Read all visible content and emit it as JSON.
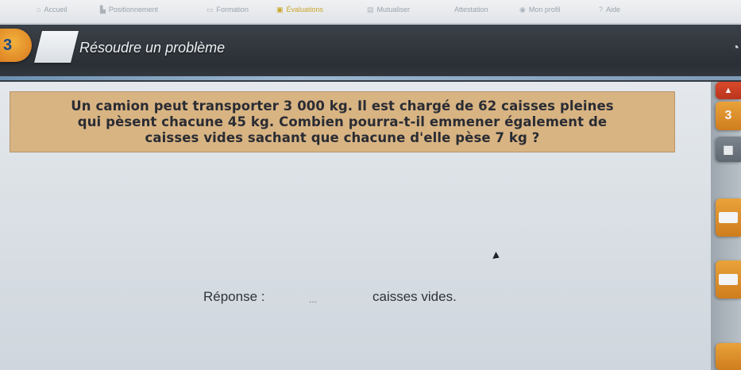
{
  "nav": {
    "items": [
      {
        "label": "Accueil",
        "icon": "home-icon"
      },
      {
        "label": "Positionnement",
        "icon": "chart-icon"
      },
      {
        "label": "Formation",
        "icon": "book-icon"
      },
      {
        "label": "Évaluations",
        "icon": "clipboard-icon",
        "active": true
      },
      {
        "label": "Mutualiser",
        "icon": "share-icon"
      },
      {
        "label": "Attestation",
        "icon": ""
      },
      {
        "label": "Mon profil",
        "icon": "user-icon"
      },
      {
        "label": "Aide",
        "icon": "help-icon"
      }
    ]
  },
  "header": {
    "level": "3",
    "title": "Résoudre un problème"
  },
  "question": {
    "text": "Un camion peut transporter 3 000 kg. Il est chargé de 62 caisses pleines qui pèsent chacune 45 kg. Combien pourra-t-il emmener également de caisses vides sachant que chacune d'elle pèse 7 kg ?"
  },
  "answer": {
    "label": "Réponse :",
    "placeholder": "...",
    "unit": "caisses vides."
  },
  "sidebar": {
    "step": "3"
  },
  "colors": {
    "question_bg": "#d8b483",
    "header_bg": "#2f353b",
    "accent_orange": "#e9a23a",
    "accent_red": "#d8492b"
  }
}
